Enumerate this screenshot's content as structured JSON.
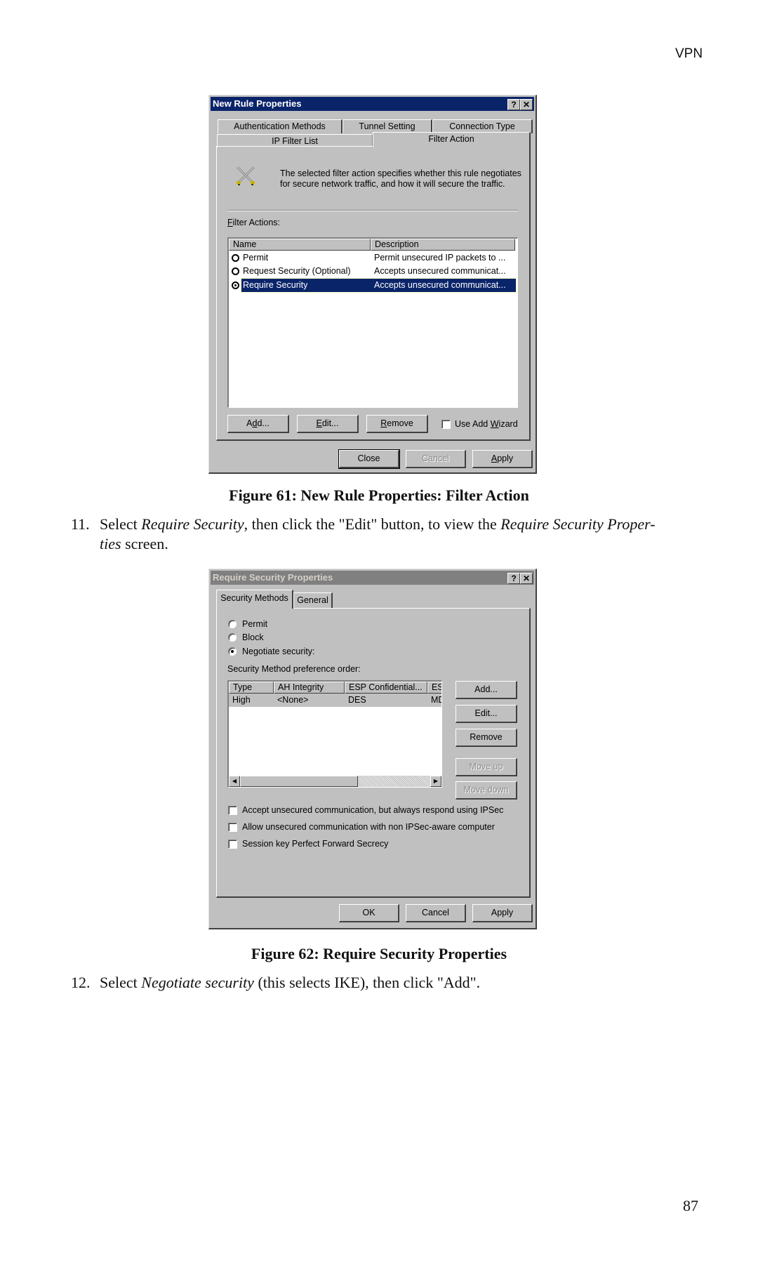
{
  "header": {
    "running_head": "VPN"
  },
  "page_number": "87",
  "figure61": {
    "caption": "Figure 61:  New Rule Properties: Filter Action",
    "dialog": {
      "title": "New Rule Properties",
      "help_button": "?",
      "close_button": "✕",
      "tabs_back": [
        "Authentication Methods",
        "Tunnel Setting",
        "Connection Type"
      ],
      "tabs_front": [
        "IP Filter List",
        "Filter Action"
      ],
      "active_tab": "Filter Action",
      "icon": "crossed-swords-icon",
      "description": "The selected filter action specifies whether this rule negotiates for secure network traffic, and how it will secure the traffic.",
      "description_line1": "The selected filter action specifies whether this rule negotiates",
      "description_line2": "for secure network traffic, and how it will secure the traffic.",
      "filter_actions_label_accel": "F",
      "filter_actions_label_rest": "ilter Actions:",
      "columns": [
        "Name",
        "Description"
      ],
      "rows": [
        {
          "name": "Permit",
          "description": "Permit unsecured IP packets to ...",
          "selected": false
        },
        {
          "name": "Request Security (Optional)",
          "description": "Accepts unsecured communicat...",
          "selected": false
        },
        {
          "name": "Require Security",
          "description": "Accepts unsecured communicat...",
          "selected": true
        }
      ],
      "buttons": {
        "add": {
          "pre": "A",
          "accel": "d",
          "post": "d..."
        },
        "edit": {
          "pre": "",
          "accel": "E",
          "post": "dit..."
        },
        "remove": {
          "pre": "",
          "accel": "R",
          "post": "emove"
        }
      },
      "use_add_wizard": {
        "pre": "Use Add ",
        "accel": "W",
        "post": "izard",
        "checked": false
      },
      "footer": {
        "close": "Close",
        "cancel": "Cancel",
        "cancel_disabled": true,
        "apply_accel": "A",
        "apply_rest": "pply"
      }
    }
  },
  "step11": {
    "number": "11.",
    "text_a": "Select ",
    "text_b_italic": "Require Security",
    "text_c": ", then click the \"Edit\" button, to view the ",
    "text_d_italic": "Require Security Proper-",
    "text_e_italic": "ties",
    "text_f": " screen."
  },
  "figure62": {
    "caption": "Figure 62: Require Security Properties",
    "dialog": {
      "title": "Require Security Properties",
      "help_button": "?",
      "close_button": "✕",
      "tabs": [
        "Security Methods",
        "General"
      ],
      "active_tab": "Security Methods",
      "radios": [
        {
          "label": "Permit",
          "checked": false
        },
        {
          "label": "Block",
          "checked": false
        },
        {
          "label": "Negotiate security:",
          "checked": true
        }
      ],
      "list_label": "Security Method preference order:",
      "columns": [
        "Type",
        "AH Integrity",
        "ESP Confidential...",
        "ES"
      ],
      "rows": [
        {
          "type": "High",
          "ah": "<None>",
          "esp_conf": "DES",
          "esp_int": "MD"
        }
      ],
      "side_buttons": [
        {
          "label": "Add...",
          "disabled": false
        },
        {
          "label": "Edit...",
          "disabled": false
        },
        {
          "label": "Remove",
          "disabled": false
        },
        {
          "label": "Move up",
          "disabled": true
        },
        {
          "label": "Move down",
          "disabled": true
        }
      ],
      "checkboxes": [
        {
          "label": "Accept unsecured communication, but always respond using IPSec",
          "checked": false
        },
        {
          "label": "Allow unsecured communication with non IPSec-aware computer",
          "checked": false
        },
        {
          "label": "Session key Perfect Forward Secrecy",
          "checked": false
        }
      ],
      "footer": {
        "ok": "OK",
        "cancel": "Cancel",
        "apply": "Apply"
      }
    }
  },
  "step12": {
    "number": "12.",
    "text_a": "Select ",
    "text_b_italic": "Negotiate security",
    "text_c": " (this selects IKE), then click \"Add\"."
  }
}
